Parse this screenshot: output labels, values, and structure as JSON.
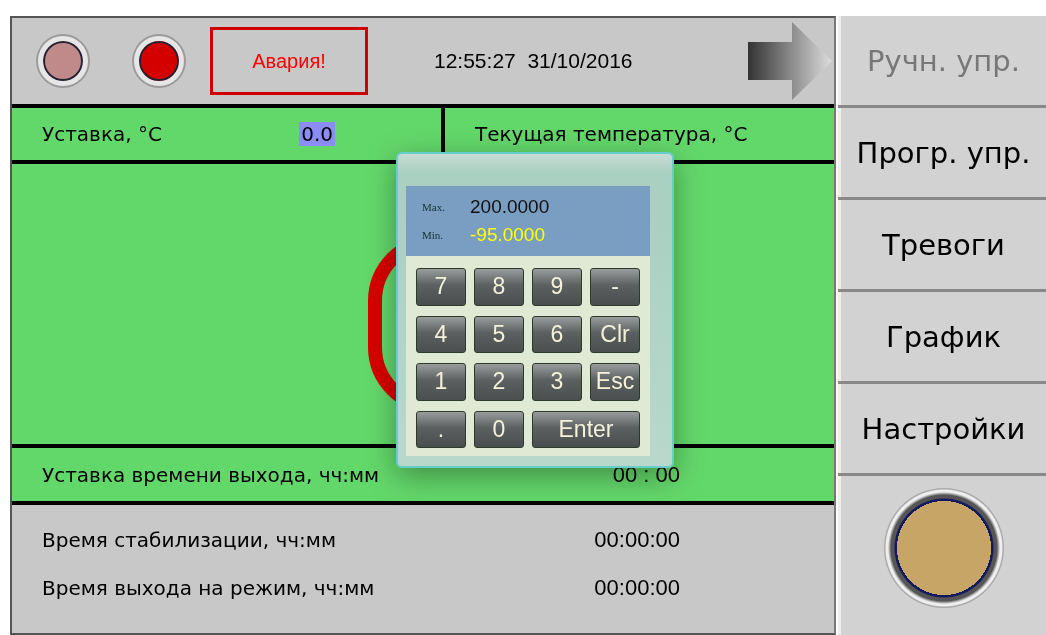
{
  "top_bar": {
    "lamps": [
      {
        "color": "#c08a8a"
      },
      {
        "color": "#d40000"
      }
    ],
    "alarm": "Авария!",
    "clock": "12:55:27  31/10/2016"
  },
  "setpoint": {
    "label": "Уставка, °C",
    "value": "0.0",
    "selected": true
  },
  "current": {
    "label": "Текущая температура, °C"
  },
  "time_setpoint": {
    "label": "Уставка времени выхода, чч:мм",
    "value": "00 : 00"
  },
  "info_rows": [
    {
      "label": "Время стабилизации, чч:мм",
      "value": "00:00:00"
    },
    {
      "label": "Время выхода на режим, чч:мм",
      "value": "00:00:00"
    }
  ],
  "menu": [
    {
      "label": "Ручн. упр.",
      "disabled": true
    },
    {
      "label": "Прогр. упр.",
      "disabled": false
    },
    {
      "label": "Тревоги",
      "disabled": false
    },
    {
      "label": "График",
      "disabled": false
    },
    {
      "label": "Настройки",
      "disabled": false
    }
  ],
  "keypad": {
    "max_label": "Max.",
    "max": "200.0000",
    "min_label": "Min.",
    "min": "-95.0000",
    "keys": [
      {
        "label": "7",
        "kind": "key"
      },
      {
        "label": "8",
        "kind": "key"
      },
      {
        "label": "9",
        "kind": "key"
      },
      {
        "label": "-",
        "kind": "key"
      },
      {
        "label": "4",
        "kind": "key"
      },
      {
        "label": "5",
        "kind": "key"
      },
      {
        "label": "6",
        "kind": "key"
      },
      {
        "label": "Clr",
        "kind": "key"
      },
      {
        "label": "1",
        "kind": "key"
      },
      {
        "label": "2",
        "kind": "key"
      },
      {
        "label": "3",
        "kind": "key"
      },
      {
        "label": "Esc",
        "kind": "key"
      },
      {
        "label": ".",
        "kind": "key"
      },
      {
        "label": "0",
        "kind": "key"
      },
      {
        "label": "Enter",
        "kind": "wide"
      }
    ]
  }
}
